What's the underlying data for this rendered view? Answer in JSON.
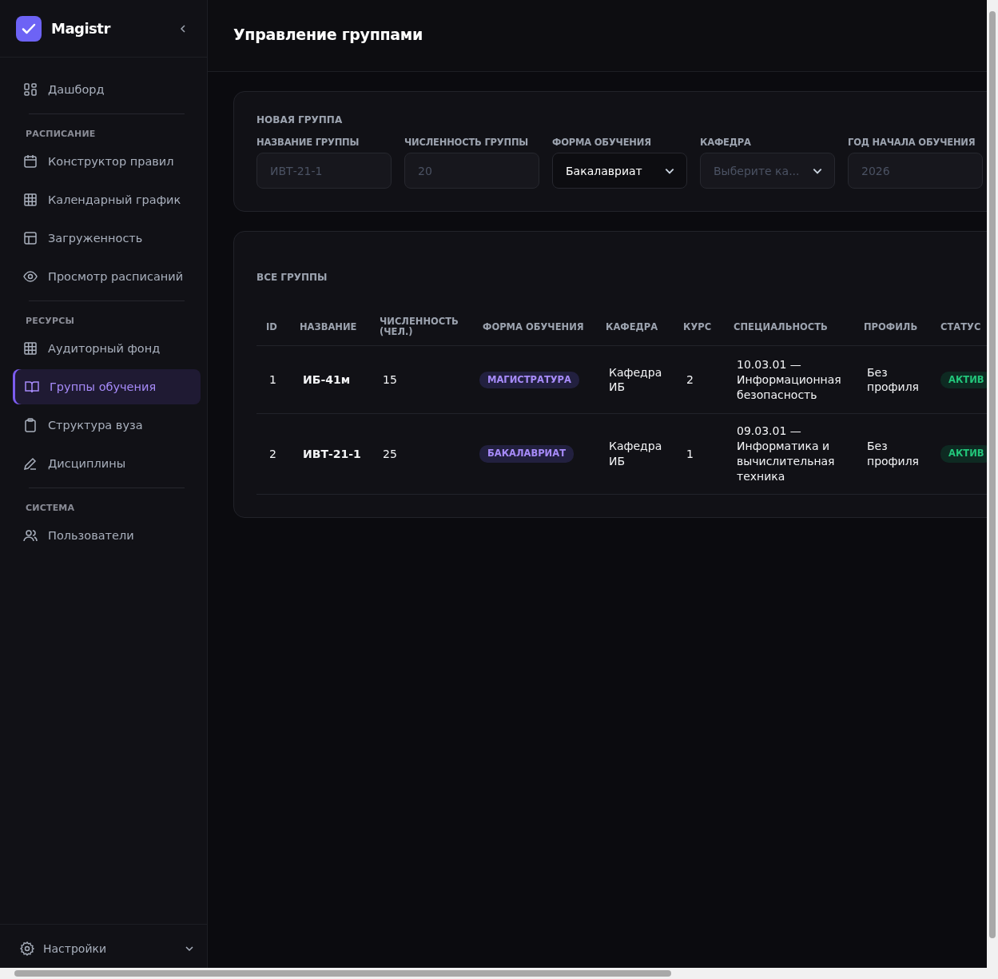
{
  "brand": {
    "name": "Magistr"
  },
  "sidebar": {
    "sections": [
      {
        "items": [
          {
            "label": "Дашборд",
            "kind": "dashboard",
            "selected": false
          }
        ]
      },
      {
        "title": "РАСПИСАНИЕ",
        "items": [
          {
            "label": "Конструктор правил",
            "kind": "calendar",
            "selected": false
          },
          {
            "label": "Календарный график",
            "kind": "grid",
            "selected": false
          },
          {
            "label": "Загруженность",
            "kind": "layout",
            "selected": false
          },
          {
            "label": "Просмотр расписаний",
            "kind": "eye",
            "selected": false
          }
        ]
      },
      {
        "title": "РЕСУРСЫ",
        "items": [
          {
            "label": "Аудиторный фонд",
            "kind": "grid",
            "selected": false
          },
          {
            "label": "Группы обучения",
            "kind": "book",
            "selected": true
          },
          {
            "label": "Структура вуза",
            "kind": "clipboard",
            "selected": false
          },
          {
            "label": "Дисциплины",
            "kind": "pen",
            "selected": false
          }
        ]
      },
      {
        "title": "СИСТЕМА",
        "items": [
          {
            "label": "Пользователи",
            "kind": "users",
            "selected": false
          }
        ]
      }
    ],
    "settings": {
      "label": "Настройки"
    }
  },
  "page": {
    "title": "Управление группами"
  },
  "new_group": {
    "title": "НОВАЯ ГРУППА",
    "fields": [
      {
        "label": "НАЗВАНИЕ ГРУППЫ",
        "kind": "input",
        "placeholder": "ИВТ-21-1"
      },
      {
        "label": "ЧИСЛЕННОСТЬ ГРУППЫ",
        "kind": "input",
        "placeholder": "20"
      },
      {
        "label": "ФОРМА ОБУЧЕНИЯ",
        "kind": "select",
        "value": "Бакалавриат"
      },
      {
        "label": "КАФЕДРА",
        "kind": "select",
        "placeholder": "Выберите ка..."
      },
      {
        "label": "ГОД НАЧАЛА ОБУЧЕНИЯ",
        "kind": "input",
        "placeholder": "2026"
      }
    ]
  },
  "groups_table": {
    "title": "ВСЕ ГРУППЫ",
    "columns": [
      "ID",
      "НАЗВАНИЕ",
      "ЧИСЛЕННОСТЬ (ЧЕЛ.)",
      "ФОРМА ОБУЧЕНИЯ",
      "КАФЕДРА",
      "КУРС",
      "СПЕЦИАЛЬНОСТЬ",
      "ПРОФИЛЬ",
      "СТАТУС"
    ],
    "rows": [
      {
        "id": "1",
        "name": "ИБ-41м",
        "size": "15",
        "form": "МАГИСТРАТУРА",
        "department": "Кафедра ИБ",
        "course": "2",
        "specialty": "10.03.01 — Информационная безопасность",
        "profile": "Без профиля",
        "status": "АКТИВ"
      },
      {
        "id": "2",
        "name": "ИВТ-21-1",
        "size": "25",
        "form": "БАКАЛАВРИАТ",
        "department": "Кафедра ИБ",
        "course": "1",
        "specialty": "09.03.01 — Информатика и вычислительная техника",
        "profile": "Без профиля",
        "status": "АКТИВ"
      }
    ]
  }
}
